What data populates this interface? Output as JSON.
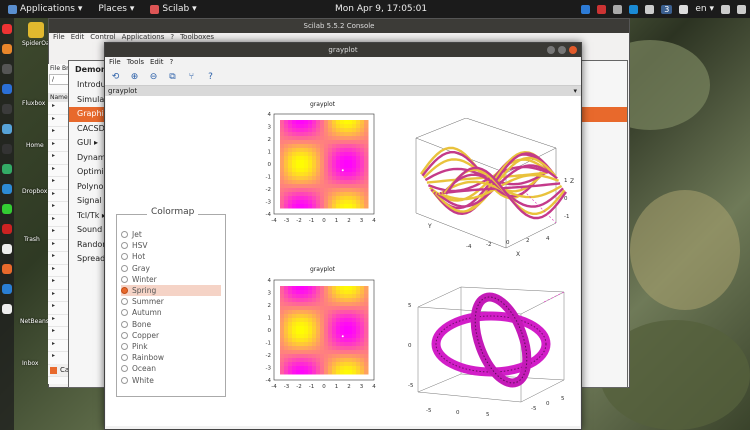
{
  "topbar": {
    "applications": "Applications ▾",
    "places": "Places ▾",
    "app_name": "Scilab ▾",
    "clock": "Mon Apr  9, 17:05:01",
    "workspace": "3",
    "lang": "en ▾"
  },
  "desktop": {
    "icons": [
      "SpiderOak",
      "Fluxbox",
      "Home",
      "Dropbox",
      "Trash",
      "NetBeans",
      "Inbox"
    ]
  },
  "console": {
    "title": "Scilab 5.5.2 Console",
    "menu": [
      "File",
      "Edit",
      "Control",
      "Applications",
      "?",
      "Toolboxes"
    ],
    "right_marks": [
      "//",
      "//"
    ]
  },
  "filebrowser": {
    "title": "File Br",
    "path": "/",
    "name_header": "Name",
    "case_label": "Case sensitiv"
  },
  "demos": {
    "header": "Demons",
    "items": [
      "Introdu",
      "Simulati",
      "Graphic",
      "CACSD ▸",
      "GUI ▸",
      "Dynamic",
      "Optimiza",
      "Polynom",
      "Signal P",
      "Tcl/Tk ▸",
      "Sound f",
      "Random",
      "Spreadsh"
    ]
  },
  "graphwin": {
    "title": "grayplot",
    "menu": [
      "File",
      "Tools",
      "Edit",
      "?"
    ],
    "subheader": "grayplot",
    "toolbar": [
      "rotate",
      "zoom-in",
      "zoom-out",
      "datatip",
      "editor",
      "help"
    ]
  },
  "colormap": {
    "label": "Colormap",
    "options": [
      "Jet",
      "HSV",
      "Hot",
      "Gray",
      "Winter",
      "Spring",
      "Summer",
      "Autumn",
      "Bone",
      "Copper",
      "Pink",
      "Rainbow",
      "Ocean",
      "White"
    ],
    "selected": "Spring"
  },
  "chart_data": [
    {
      "type": "heatmap",
      "title": "grayplot",
      "xlim": [
        -4,
        4
      ],
      "ylim": [
        -4,
        4
      ],
      "xticks": [
        "-4",
        "-3",
        "-2",
        "-1",
        "0",
        "1",
        "2",
        "3",
        "4"
      ],
      "yticks": [
        "4",
        "3",
        "2",
        "1",
        "0",
        "-1",
        "-2",
        "-3",
        "-4"
      ],
      "colormap": "spring"
    },
    {
      "type": "heatmap",
      "title": "grayplot",
      "xlim": [
        -4,
        4
      ],
      "ylim": [
        -4,
        4
      ],
      "xticks": [
        "-4",
        "-3",
        "-2",
        "-1",
        "0",
        "1",
        "2",
        "3",
        "4"
      ],
      "yticks": [
        "4",
        "3",
        "2",
        "1",
        "0",
        "-1",
        "-2",
        "-3",
        "-4"
      ],
      "colormap": "spring"
    },
    {
      "type": "surface",
      "axes": {
        "x": "X",
        "y": "Y",
        "z": "Z"
      },
      "xticks": [
        "-4",
        "-2",
        "0",
        "2",
        "4"
      ],
      "yticks": [
        "-4",
        "-2",
        "0",
        "2",
        "4"
      ],
      "zticks": [
        "-1",
        "0",
        "1"
      ]
    },
    {
      "type": "torus",
      "xticks": [
        "-5",
        "0",
        "5"
      ],
      "yticks": [
        "-5",
        "0",
        "5"
      ],
      "zticks": [
        "-5",
        "0",
        "5"
      ]
    }
  ],
  "colors": {
    "accent": "#e8692c",
    "spring_magenta": "#ff00ff",
    "spring_yellow": "#ffff00"
  }
}
